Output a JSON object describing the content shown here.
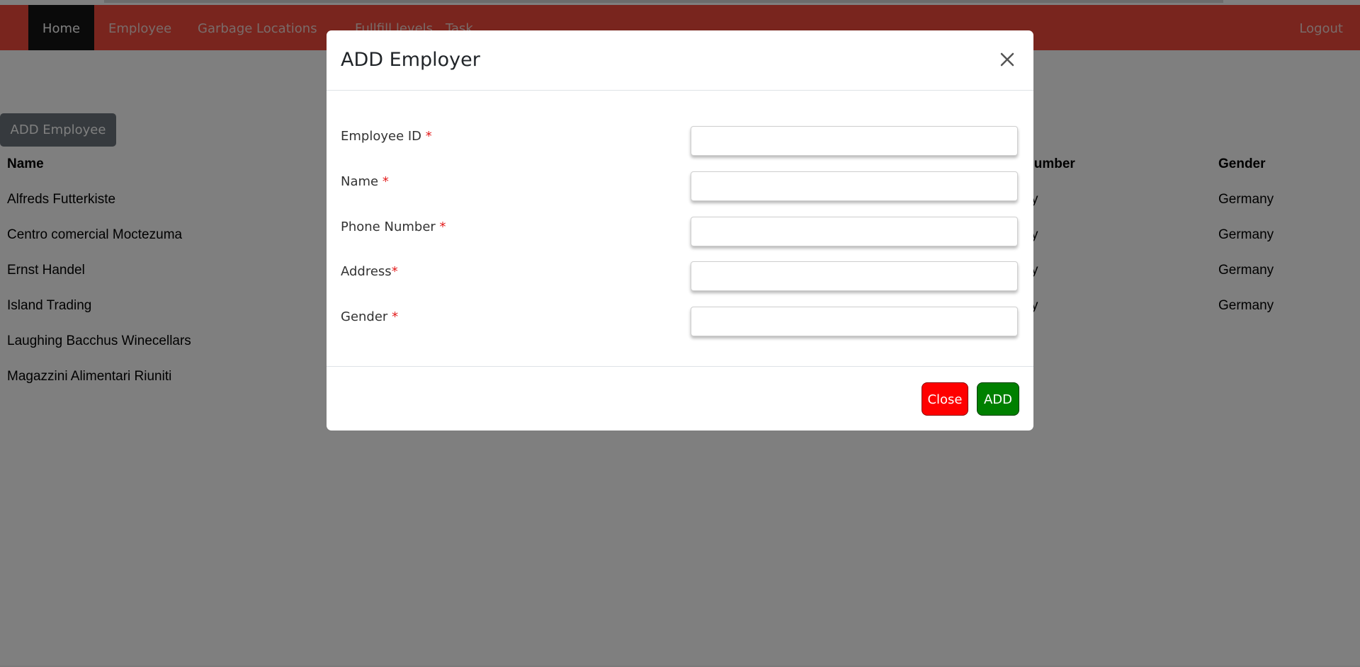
{
  "navbar": {
    "items": [
      {
        "label": "Home"
      },
      {
        "label": "Employee"
      },
      {
        "label": "Garbage Locations"
      },
      {
        "label": "Fullfill levels"
      },
      {
        "label": "Task"
      }
    ],
    "logout_label": "Logout",
    "color": "#f34a3c",
    "active_color": "#141414"
  },
  "page": {
    "add_button_label": "ADD Employee"
  },
  "table": {
    "headers": [
      "Name",
      "Number",
      "Gender"
    ],
    "rows": [
      {
        "name": "Alfreds Futterkiste",
        "number_partial": "y",
        "gender": "Germany"
      },
      {
        "name": "Centro comercial Moctezuma",
        "number_partial": "y",
        "gender": "Germany"
      },
      {
        "name": "Ernst Handel",
        "number_partial": "y",
        "gender": "Germany"
      },
      {
        "name": "Island Trading",
        "number_partial": "y",
        "gender": "Germany"
      },
      {
        "name": "Laughing Bacchus Winecellars",
        "number_partial": "",
        "gender": ""
      },
      {
        "name": "Magazzini Alimentari Riuniti",
        "number_partial": "",
        "gender": ""
      }
    ]
  },
  "modal": {
    "title": "ADD Employer",
    "close_icon": "close-icon",
    "required_marker": "*",
    "fields": [
      {
        "label": "Employee ID ",
        "value": "",
        "placeholder": ""
      },
      {
        "label": "Name ",
        "value": "",
        "placeholder": ""
      },
      {
        "label": "Phone Number ",
        "value": "",
        "placeholder": ""
      },
      {
        "label": "Address",
        "value": "",
        "placeholder": ""
      },
      {
        "label": "Gender ",
        "value": "",
        "placeholder": ""
      }
    ],
    "close_button_label": "Close",
    "add_button_label": "ADD",
    "close_button_color": "#ff0000",
    "add_button_color": "#008000"
  }
}
